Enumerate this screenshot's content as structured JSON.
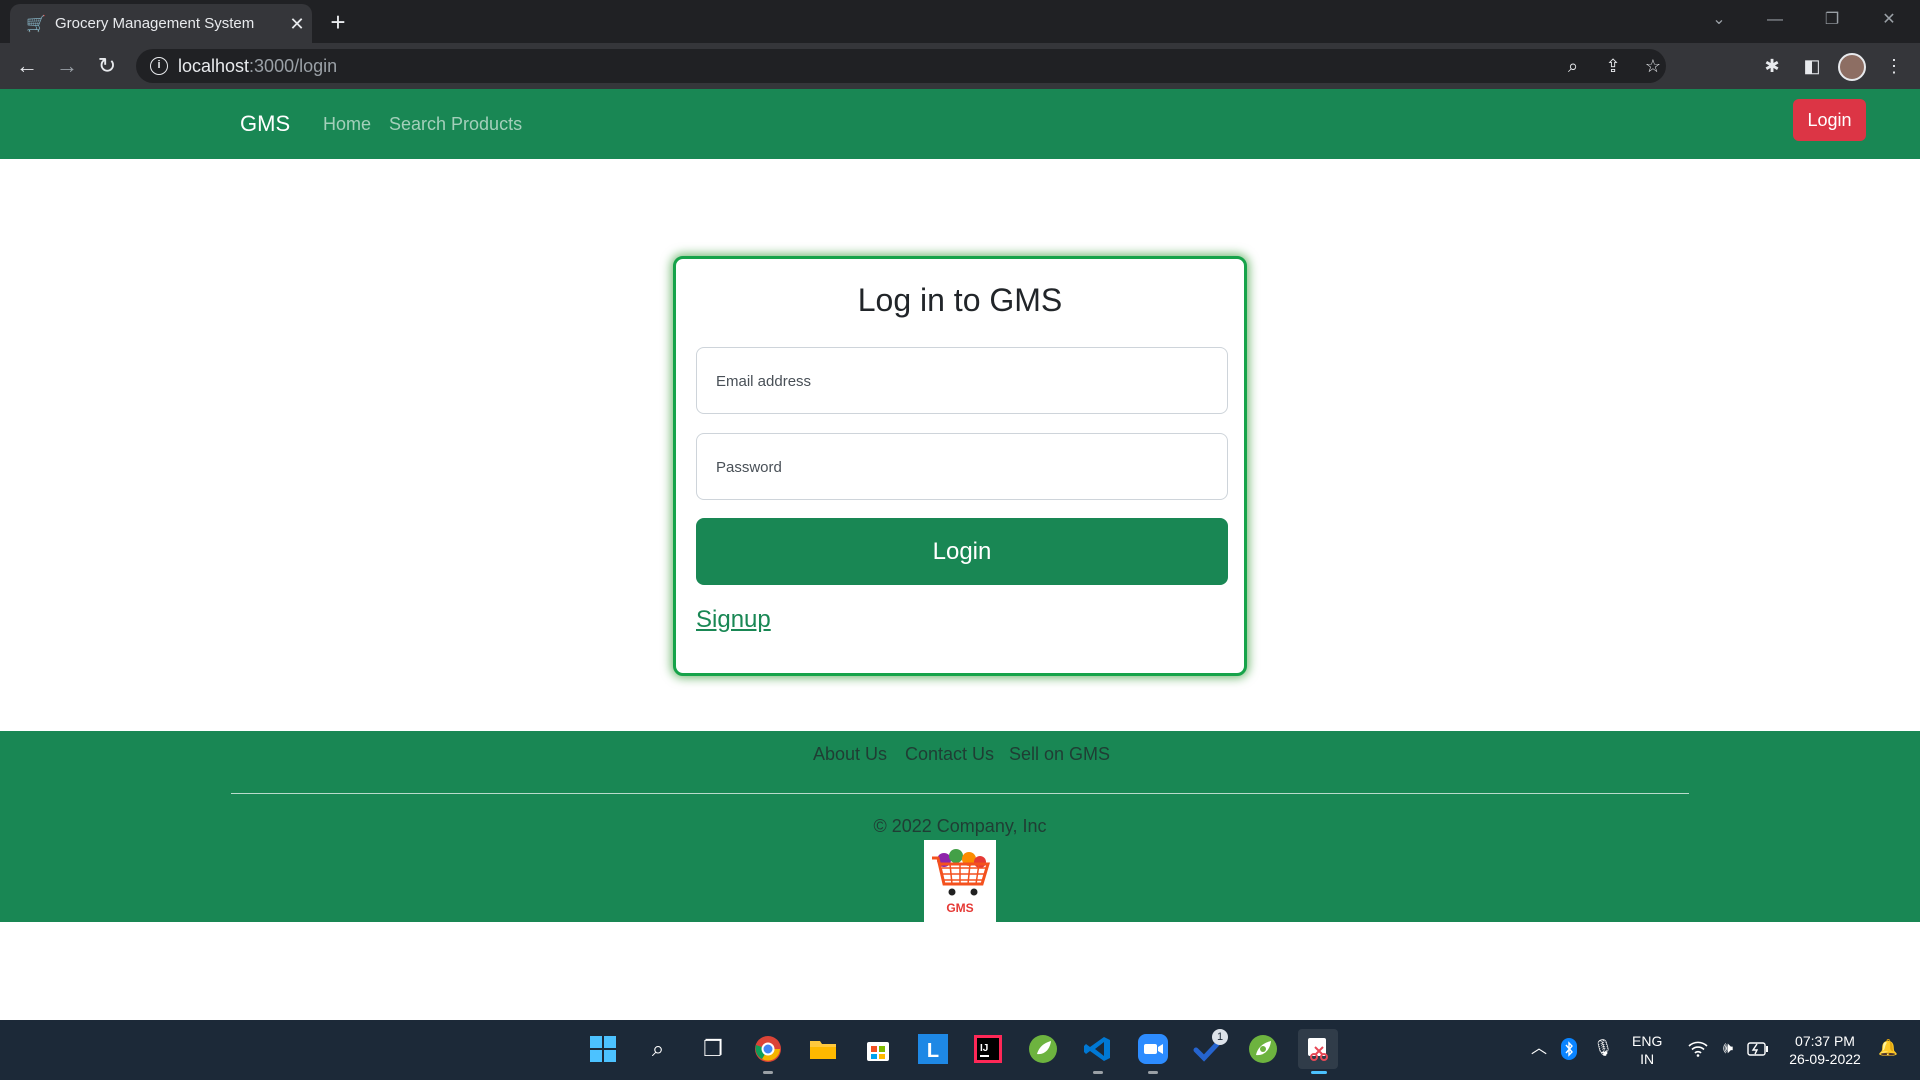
{
  "browser": {
    "tab_title": "Grocery Management System",
    "url_host": "localhost",
    "url_path": ":3000/login"
  },
  "navbar": {
    "brand": "GMS",
    "links": [
      "Home",
      "Search Products"
    ],
    "login_button": "Login"
  },
  "login_card": {
    "title": "Log in to GMS",
    "email_label": "Email address",
    "password_label": "Password",
    "submit_label": "Login",
    "signup_link": "Signup"
  },
  "footer": {
    "links": [
      "About Us",
      "Contact Us",
      "Sell on GMS"
    ],
    "copyright": "© 2022 Company, Inc",
    "logo_text": "GMS"
  },
  "taskbar": {
    "apps": [
      "windows-start",
      "search",
      "task-view",
      "chrome",
      "file-explorer",
      "microsoft-store",
      "app-l",
      "intellij-idea",
      "spring-tools",
      "vs-code",
      "zoom",
      "todo",
      "spring-boot",
      "snipping-tool"
    ],
    "todo_badge": "1",
    "language": "ENG",
    "region": "IN",
    "time": "07:37 PM",
    "date": "26-09-2022"
  },
  "colors": {
    "brand_green": "#198754",
    "danger_red": "#dc3545",
    "card_border": "#16a34a"
  }
}
